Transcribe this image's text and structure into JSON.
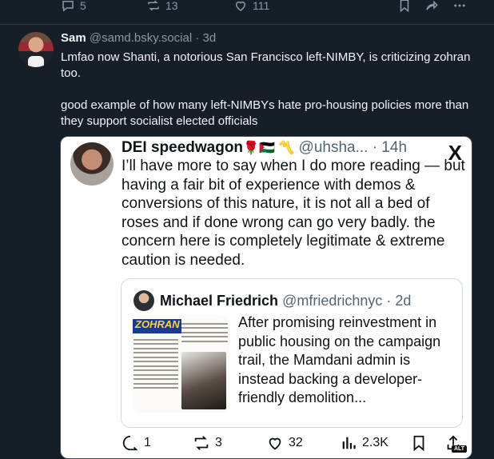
{
  "previous_post": {
    "replies": "5",
    "reposts": "13",
    "likes": "111",
    "icons": [
      "reply-icon",
      "repost-icon",
      "like-icon",
      "bookmark-icon",
      "share-icon",
      "more-icon"
    ]
  },
  "post": {
    "author_name": "Sam",
    "author_handle": "@samd.bsky.social",
    "time": "· 3d",
    "paragraph1": "Lmfao now Shanti, a notorious San Francisco left-NIMBY, is criticizing zohran too.",
    "paragraph2": "good example of how many left-NIMBYs hate pro-housing policies more than they support socialist elected officials"
  },
  "embed": {
    "author_name": "DEI speedwagon",
    "author_emoji": "🌹🇵🇸 〽️",
    "author_handle": "@uhsha... · 14h",
    "platform_logo": "X",
    "text": "I’ll have more to say when I do more reading — but having a fair bit of experience with demos & conversions of this nature, it is not all a bed of roses and if done wrong can go very badly. the concern here is completely legitimate & extreme caution is needed.",
    "quote": {
      "author_name": "Michael Friedrich",
      "author_handle": "@mfriedrichnyc · 2d",
      "image_banner": "ZOHRAN",
      "text": "After promising reinvestment in public housing on the campaign trail, the Mamdani admin is instead backing a developer-friendly demolition..."
    },
    "actions": {
      "replies": "1",
      "reposts": "3",
      "likes": "32",
      "views": "2.3K",
      "alt_badge": "ALT"
    }
  },
  "colors": {
    "background": "#161e27",
    "divider": "#2e3a47",
    "muted": "#8b98a5",
    "embed_bg": "#ffffff"
  }
}
